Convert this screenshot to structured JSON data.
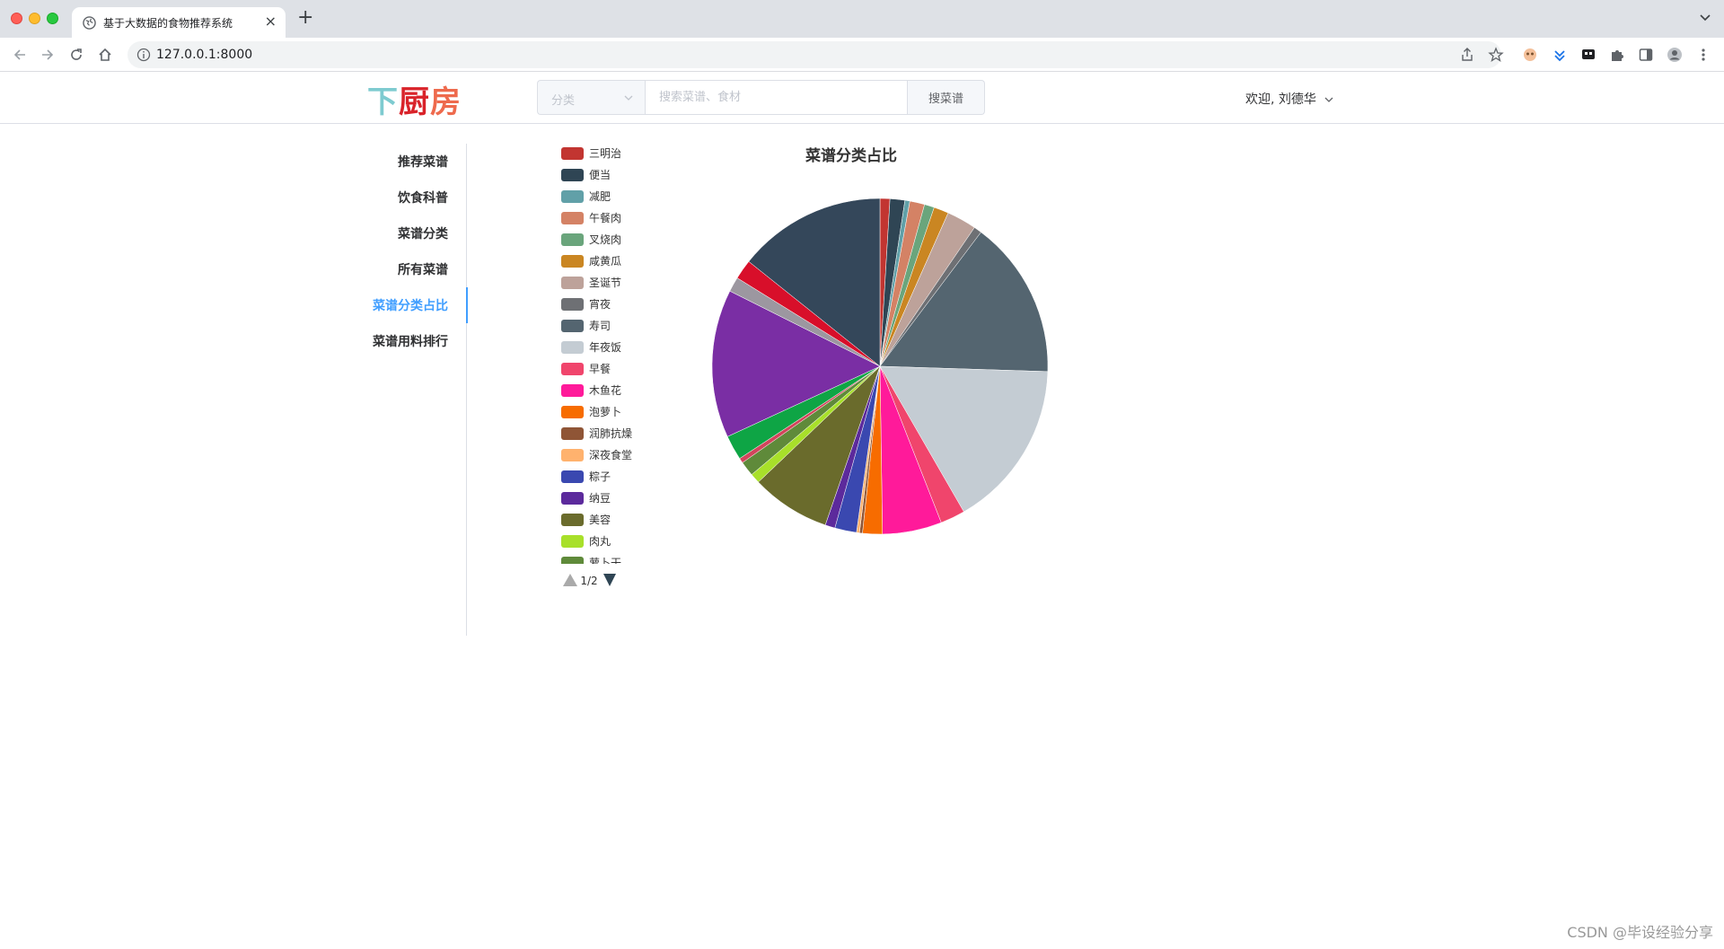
{
  "browser": {
    "tab_title": "基于大数据的食物推荐系统",
    "url": "127.0.0.1:8000"
  },
  "header": {
    "logo_chars": [
      "下",
      "厨",
      "房"
    ],
    "category_placeholder": "分类",
    "search_placeholder": "搜索菜谱、食材",
    "search_button": "搜菜谱",
    "user_greeting": "欢迎, 刘德华"
  },
  "sidebar": {
    "items": [
      {
        "label": "推荐菜谱",
        "active": false
      },
      {
        "label": "饮食科普",
        "active": false
      },
      {
        "label": "菜谱分类",
        "active": false
      },
      {
        "label": "所有菜谱",
        "active": false
      },
      {
        "label": "菜谱分类占比",
        "active": true
      },
      {
        "label": "菜谱用料排行",
        "active": false
      }
    ]
  },
  "chart_data": {
    "type": "pie",
    "title": "菜谱分类占比",
    "legend_position": "left",
    "legend_page": "1/2",
    "legend_items_visible": [
      "三明治",
      "便当",
      "减肥",
      "午餐肉",
      "叉烧肉",
      "咸黄瓜",
      "圣诞节",
      "宵夜",
      "寿司",
      "年夜饭",
      "早餐",
      "木鱼花",
      "泡萝卜",
      "润肺抗燥",
      "深夜食堂",
      "粽子",
      "纳豆",
      "美容",
      "肉丸",
      "萝卜干"
    ],
    "slices": [
      {
        "name": "三明治",
        "value": 1,
        "color": "#c23531"
      },
      {
        "name": "便当",
        "value": 1.5,
        "color": "#2f4554"
      },
      {
        "name": "减肥",
        "value": 0.5,
        "color": "#61a0a8"
      },
      {
        "name": "午餐肉",
        "value": 1.5,
        "color": "#d48265"
      },
      {
        "name": "叉烧肉",
        "value": 1,
        "color": "#6aa57c"
      },
      {
        "name": "咸黄瓜",
        "value": 1.5,
        "color": "#ca8622"
      },
      {
        "name": "圣诞节",
        "value": 3,
        "color": "#bda29a"
      },
      {
        "name": "宵夜",
        "value": 0.8,
        "color": "#6e7074"
      },
      {
        "name": "寿司",
        "value": 16,
        "color": "#546570"
      },
      {
        "name": "年夜饭",
        "value": 17,
        "color": "#c4ccd3"
      },
      {
        "name": "早餐",
        "value": 2.5,
        "color": "#f0456c"
      },
      {
        "name": "木鱼花",
        "value": 6,
        "color": "#ff1a9a"
      },
      {
        "name": "泡萝卜",
        "value": 2,
        "color": "#f76c00"
      },
      {
        "name": "润肺抗燥",
        "value": 0.3,
        "color": "#8f5536"
      },
      {
        "name": "深夜食堂",
        "value": 0.3,
        "color": "#ffb26e"
      },
      {
        "name": "粽子",
        "value": 2.2,
        "color": "#3a48b0"
      },
      {
        "name": "纳豆",
        "value": 1,
        "color": "#5c2a9c"
      },
      {
        "name": "美容",
        "value": 8,
        "color": "#6a6b2c"
      },
      {
        "name": "肉丸",
        "value": 1,
        "color": "#a8e02a"
      },
      {
        "name": "萝卜干",
        "value": 1.5,
        "color": "#5f8a3a"
      },
      {
        "name": "",
        "value": 0.5,
        "color": "#d2455c"
      },
      {
        "name": "",
        "value": 2.5,
        "color": "#0ea545"
      },
      {
        "name": "",
        "value": 15,
        "color": "#7a2ea4"
      },
      {
        "name": "",
        "value": 1.5,
        "color": "#9c97a0"
      },
      {
        "name": "",
        "value": 2,
        "color": "#d80f2a"
      },
      {
        "name": "",
        "value": 15,
        "color": "#34475a"
      }
    ]
  },
  "footer": {
    "credit": "CSDN @毕设经验分享"
  }
}
